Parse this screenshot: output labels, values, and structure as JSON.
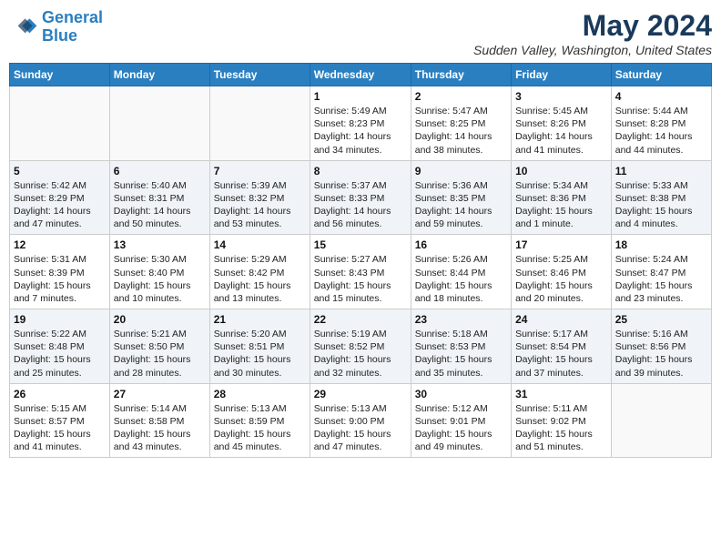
{
  "header": {
    "logo_line1": "General",
    "logo_line2": "Blue",
    "month_title": "May 2024",
    "location": "Sudden Valley, Washington, United States"
  },
  "days_of_week": [
    "Sunday",
    "Monday",
    "Tuesday",
    "Wednesday",
    "Thursday",
    "Friday",
    "Saturday"
  ],
  "weeks": [
    [
      {
        "day": "",
        "info": ""
      },
      {
        "day": "",
        "info": ""
      },
      {
        "day": "",
        "info": ""
      },
      {
        "day": "1",
        "info": "Sunrise: 5:49 AM\nSunset: 8:23 PM\nDaylight: 14 hours\nand 34 minutes."
      },
      {
        "day": "2",
        "info": "Sunrise: 5:47 AM\nSunset: 8:25 PM\nDaylight: 14 hours\nand 38 minutes."
      },
      {
        "day": "3",
        "info": "Sunrise: 5:45 AM\nSunset: 8:26 PM\nDaylight: 14 hours\nand 41 minutes."
      },
      {
        "day": "4",
        "info": "Sunrise: 5:44 AM\nSunset: 8:28 PM\nDaylight: 14 hours\nand 44 minutes."
      }
    ],
    [
      {
        "day": "5",
        "info": "Sunrise: 5:42 AM\nSunset: 8:29 PM\nDaylight: 14 hours\nand 47 minutes."
      },
      {
        "day": "6",
        "info": "Sunrise: 5:40 AM\nSunset: 8:31 PM\nDaylight: 14 hours\nand 50 minutes."
      },
      {
        "day": "7",
        "info": "Sunrise: 5:39 AM\nSunset: 8:32 PM\nDaylight: 14 hours\nand 53 minutes."
      },
      {
        "day": "8",
        "info": "Sunrise: 5:37 AM\nSunset: 8:33 PM\nDaylight: 14 hours\nand 56 minutes."
      },
      {
        "day": "9",
        "info": "Sunrise: 5:36 AM\nSunset: 8:35 PM\nDaylight: 14 hours\nand 59 minutes."
      },
      {
        "day": "10",
        "info": "Sunrise: 5:34 AM\nSunset: 8:36 PM\nDaylight: 15 hours\nand 1 minute."
      },
      {
        "day": "11",
        "info": "Sunrise: 5:33 AM\nSunset: 8:38 PM\nDaylight: 15 hours\nand 4 minutes."
      }
    ],
    [
      {
        "day": "12",
        "info": "Sunrise: 5:31 AM\nSunset: 8:39 PM\nDaylight: 15 hours\nand 7 minutes."
      },
      {
        "day": "13",
        "info": "Sunrise: 5:30 AM\nSunset: 8:40 PM\nDaylight: 15 hours\nand 10 minutes."
      },
      {
        "day": "14",
        "info": "Sunrise: 5:29 AM\nSunset: 8:42 PM\nDaylight: 15 hours\nand 13 minutes."
      },
      {
        "day": "15",
        "info": "Sunrise: 5:27 AM\nSunset: 8:43 PM\nDaylight: 15 hours\nand 15 minutes."
      },
      {
        "day": "16",
        "info": "Sunrise: 5:26 AM\nSunset: 8:44 PM\nDaylight: 15 hours\nand 18 minutes."
      },
      {
        "day": "17",
        "info": "Sunrise: 5:25 AM\nSunset: 8:46 PM\nDaylight: 15 hours\nand 20 minutes."
      },
      {
        "day": "18",
        "info": "Sunrise: 5:24 AM\nSunset: 8:47 PM\nDaylight: 15 hours\nand 23 minutes."
      }
    ],
    [
      {
        "day": "19",
        "info": "Sunrise: 5:22 AM\nSunset: 8:48 PM\nDaylight: 15 hours\nand 25 minutes."
      },
      {
        "day": "20",
        "info": "Sunrise: 5:21 AM\nSunset: 8:50 PM\nDaylight: 15 hours\nand 28 minutes."
      },
      {
        "day": "21",
        "info": "Sunrise: 5:20 AM\nSunset: 8:51 PM\nDaylight: 15 hours\nand 30 minutes."
      },
      {
        "day": "22",
        "info": "Sunrise: 5:19 AM\nSunset: 8:52 PM\nDaylight: 15 hours\nand 32 minutes."
      },
      {
        "day": "23",
        "info": "Sunrise: 5:18 AM\nSunset: 8:53 PM\nDaylight: 15 hours\nand 35 minutes."
      },
      {
        "day": "24",
        "info": "Sunrise: 5:17 AM\nSunset: 8:54 PM\nDaylight: 15 hours\nand 37 minutes."
      },
      {
        "day": "25",
        "info": "Sunrise: 5:16 AM\nSunset: 8:56 PM\nDaylight: 15 hours\nand 39 minutes."
      }
    ],
    [
      {
        "day": "26",
        "info": "Sunrise: 5:15 AM\nSunset: 8:57 PM\nDaylight: 15 hours\nand 41 minutes."
      },
      {
        "day": "27",
        "info": "Sunrise: 5:14 AM\nSunset: 8:58 PM\nDaylight: 15 hours\nand 43 minutes."
      },
      {
        "day": "28",
        "info": "Sunrise: 5:13 AM\nSunset: 8:59 PM\nDaylight: 15 hours\nand 45 minutes."
      },
      {
        "day": "29",
        "info": "Sunrise: 5:13 AM\nSunset: 9:00 PM\nDaylight: 15 hours\nand 47 minutes."
      },
      {
        "day": "30",
        "info": "Sunrise: 5:12 AM\nSunset: 9:01 PM\nDaylight: 15 hours\nand 49 minutes."
      },
      {
        "day": "31",
        "info": "Sunrise: 5:11 AM\nSunset: 9:02 PM\nDaylight: 15 hours\nand 51 minutes."
      },
      {
        "day": "",
        "info": ""
      }
    ]
  ]
}
